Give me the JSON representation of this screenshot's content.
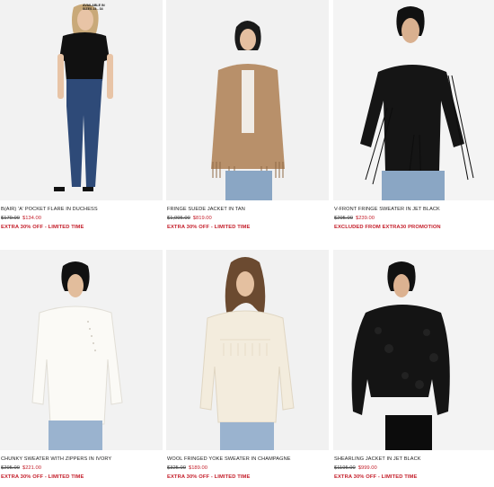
{
  "products": [
    {
      "name": "B(AIR) 'A' POCKET FLARE IN DUCHESS",
      "price_old": "$179.00",
      "price_new": "$134.00",
      "promo": "EXTRA 30% OFF - LIMITED TIME",
      "badge_line1": "AVAILABLE IN",
      "badge_line2": "SIZES 23 - 34"
    },
    {
      "name": "FRINGE SUEDE JACKET IN TAN",
      "price_old": "$1,095.00",
      "price_new": "$819.00",
      "promo": "EXTRA 30% OFF - LIMITED TIME"
    },
    {
      "name": "V-FRONT FRINGE SWEATER IN JET BLACK",
      "price_old": "$295.00",
      "price_new": "$239.00",
      "promo": "EXCLUDED FROM EXTRA30 PROMOTION"
    },
    {
      "name": "CHUNKY SWEATER WITH ZIPPERS IN IVORY",
      "price_old": "$295.00",
      "price_new": "$221.00",
      "promo": "EXTRA 30% OFF - LIMITED TIME"
    },
    {
      "name": "WOOL FRINGED YOKE SWEATER IN CHAMPAGNE",
      "price_old": "$325.00",
      "price_new": "$189.00",
      "promo": "EXTRA 30% OFF - LIMITED TIME"
    },
    {
      "name": "SHEARLING JACKET IN JET BLACK",
      "price_old": "$1195.00",
      "price_new": "$999.00",
      "promo": "EXTRA 30% OFF - LIMITED TIME"
    }
  ],
  "colors": {
    "sale_red": "#c41e2a",
    "photo_bg": "#f3f3f3"
  }
}
